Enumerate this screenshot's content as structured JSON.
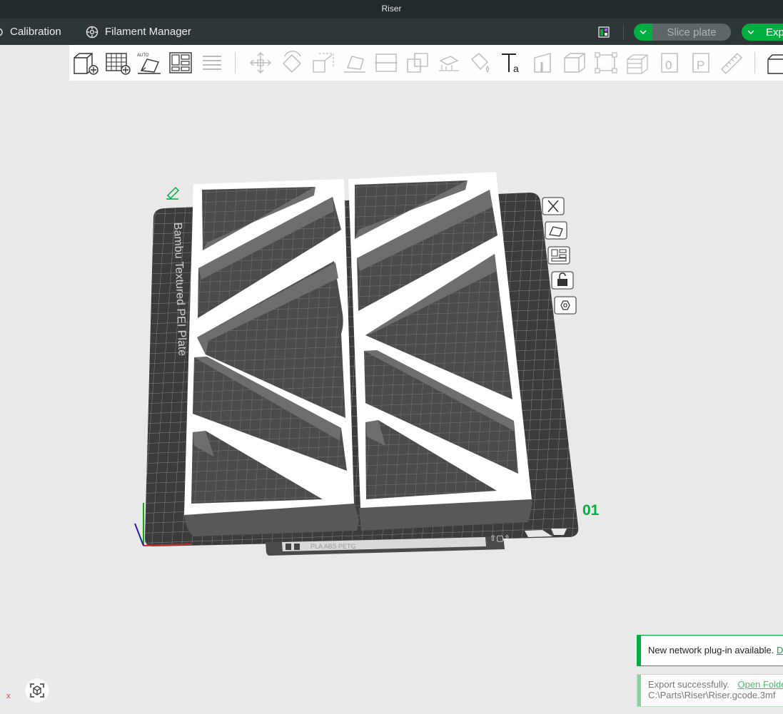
{
  "window": {
    "title": "Riser"
  },
  "menubar": {
    "calibration_label": "Calibration",
    "filament_manager_label": "Filament Manager",
    "slice_plate_label": "Slice plate",
    "export_label": "Exp"
  },
  "toolbar": {
    "tools": [
      "add-object",
      "add-plate",
      "auto-orient",
      "arrange",
      "split-to-objects",
      "move",
      "rotate",
      "scale",
      "lay-on-face",
      "cut",
      "mesh-boolean",
      "support-painting",
      "color-painting",
      "text",
      "seam-painting",
      "assembly",
      "measure",
      "variable-layer-height",
      "assembly-view",
      "brim-ears",
      "ruler",
      "more"
    ],
    "auto_label": "AUTO"
  },
  "plate": {
    "name_label": "Bambu Textured PEI Plate",
    "number": "01",
    "filament_label": "PLA ABS PETG",
    "side_buttons": [
      "close",
      "auto-orient",
      "arrange",
      "lock",
      "settings"
    ]
  },
  "notifications": [
    {
      "text": "New network plug-in available.",
      "link": "D"
    },
    {
      "text": "Export successfully.",
      "link": "Open Folde",
      "path": "C:\\Parts\\Riser\\Riser.gcode.3mf"
    }
  ],
  "axis": {
    "x_label": "x"
  },
  "colors": {
    "accent": "#00ae42",
    "menubar": "#2f3638",
    "titlebar": "#222a2c",
    "plate": "#3f3f3f",
    "model": "#ffffff"
  }
}
